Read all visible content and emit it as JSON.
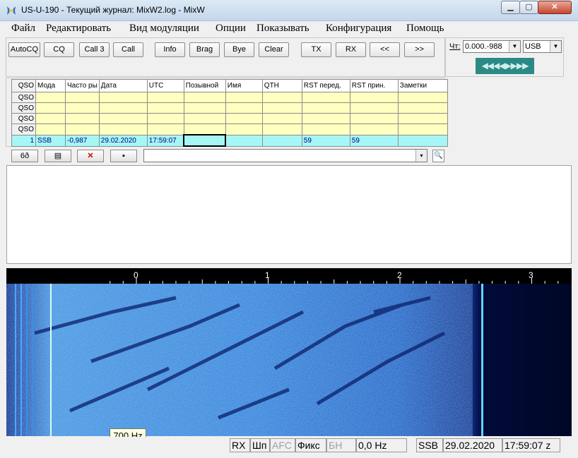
{
  "window": {
    "title": "US-U-190 - Текущий журнал: MixW2.log - MixW",
    "min": "0",
    "max": "1",
    "close": "r"
  },
  "menu": [
    "Файл",
    "Редактировать",
    "Вид модуляции",
    "Опции",
    "Показывать",
    "Конфигурация",
    "Помощь"
  ],
  "toolbar": {
    "buttons": [
      "AutoCQ",
      "CQ",
      "Call 3",
      "Call",
      "Info",
      "Brag",
      "Bye",
      "Clear",
      "TX",
      "RX",
      "<<",
      ">>"
    ]
  },
  "right_panel": {
    "freq_label": "Чт:",
    "freq_value": "0.000.-988",
    "mode_value": "USB",
    "tuning_glyphs": "◀◀◀◀▶▶▶▶"
  },
  "log": {
    "headers": [
      "QSO",
      "Мода",
      "Часто ры",
      "Дата",
      "UTC",
      "Позывной",
      "Имя",
      "QTH",
      "RST перед.",
      "RST прин.",
      "Заметки"
    ],
    "rows": [
      [
        "QSO",
        "",
        "",
        "",
        "",
        "",
        "",
        "",
        "",
        "",
        ""
      ],
      [
        "QSO",
        "",
        "",
        "",
        "",
        "",
        "",
        "",
        "",
        "",
        ""
      ],
      [
        "QSO",
        "",
        "",
        "",
        "",
        "",
        "",
        "",
        "",
        "",
        ""
      ],
      [
        "QSO",
        "",
        "",
        "",
        "",
        "",
        "",
        "",
        "",
        "",
        ""
      ]
    ],
    "current": [
      "1",
      "SSB",
      "-0,987",
      "29.02.2020",
      "17:59:07",
      "",
      "",
      "",
      "59",
      "59",
      ""
    ]
  },
  "log_tools": {
    "glasses": "6ð",
    "edit": "▤",
    "delete": "✕",
    "save": "▪",
    "search": "🔍",
    "dropdown": "▾"
  },
  "scale": {
    "labels": [
      "0",
      "1",
      "2",
      "3"
    ],
    "left_marker": "7"
  },
  "waterfall": {
    "hz_label": "700 Hz"
  },
  "status": {
    "rx": "RX",
    "shp": "Шп",
    "afc": "AFC",
    "fix": "Фикс",
    "bn": "БН",
    "offset": "0,0 Hz",
    "mode": "SSB",
    "date": "29.02.2020",
    "time": "17:59:07 z"
  },
  "colors": {
    "waterfall_bg": "#000a3a",
    "current_row": "#a6f6f6",
    "log_row": "#ffffc0",
    "tuning": "#2a8a85"
  }
}
